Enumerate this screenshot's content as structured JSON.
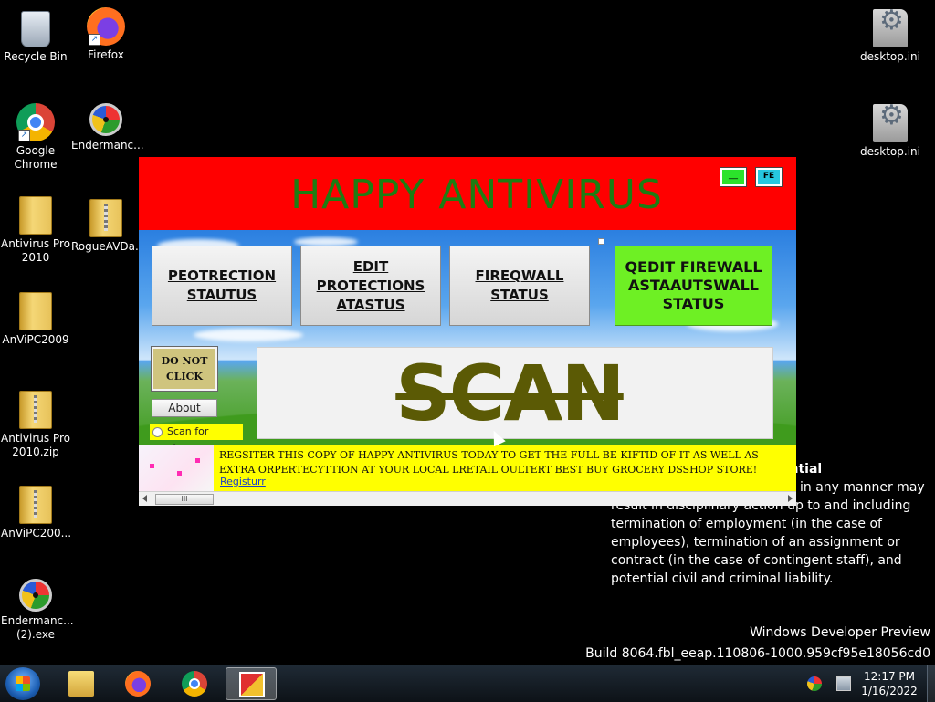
{
  "desktop": {
    "icons": [
      {
        "label": "Recycle Bin",
        "icon": "recycle-bin-icon"
      },
      {
        "label": "Firefox",
        "icon": "firefox-icon"
      },
      {
        "label": "Google Chrome",
        "icon": "chrome-icon"
      },
      {
        "label": "Endermanc...",
        "icon": "endermanch-icon"
      },
      {
        "label": "Antivirus Pro 2010",
        "icon": "folder-icon"
      },
      {
        "label": "RogueAVDa...",
        "icon": "zip-folder-icon"
      },
      {
        "label": "AnViPC2009",
        "icon": "folder-icon"
      },
      {
        "label": "Antivirus Pro 2010.zip",
        "icon": "zip-folder-icon"
      },
      {
        "label": "AnViPC200...",
        "icon": "zip-folder-icon"
      },
      {
        "label": "Endermanc... (2).exe",
        "icon": "endermanch-icon"
      },
      {
        "label": "desktop.ini",
        "icon": "settings-file-icon"
      },
      {
        "label": "desktop.ini",
        "icon": "settings-file-icon"
      }
    ],
    "legal_text": {
      "heading": "dential",
      "body": "in any manner may result in disciplinary action up to and including termination of employment (in the case of employees), termination of an assignment or contract (in the case of contingent staff), and potential civil and criminal liability."
    },
    "watermark": {
      "line1": "Windows Developer Preview",
      "line2": "Build 8064.fbl_eeap.110806-1000.959cf95e18056cd0"
    }
  },
  "antivirus": {
    "title": "HAPPY ANTIVIRUS",
    "min_label": "__",
    "close_label": "FE",
    "tiles": [
      {
        "line1": "PEOTRECTION",
        "line2": "STAUTUS",
        "line3": ""
      },
      {
        "line1": "EDIT",
        "line2": "PROTECTIONS",
        "line3": "ATASTUS"
      },
      {
        "line1": "FIREQWALL",
        "line2": "STATUS",
        "line3": ""
      },
      {
        "line1": "QEDIT FIREWALL",
        "line2": "ASTAAUTSWALL",
        "line3": "STATUS"
      }
    ],
    "do_not_click": {
      "line1": "DO NOT",
      "line2": "CLICK"
    },
    "about_label": "About",
    "scan_for_viruses_label": "Scan for viruses",
    "scan_label": "SCAN",
    "banner": {
      "text": "REGSITER THIS COPY OF HAPPY ANTIVIRUS TODAY TO GET THE FULL BE KIFTID OF IT AS WELL AS EXTRA  ORPERTECYTTION AT YOUR LOCAL LRETAIL OULTERT BEST BUY GROCERY DSSHOP STORE!",
      "link": "Registurr"
    },
    "scroll_thumb_label": "III"
  },
  "taskbar": {
    "clock_time": "12:17 PM",
    "clock_date": "1/16/2022",
    "items": [
      "File Explorer",
      "Firefox",
      "Google Chrome",
      "Happy Antivirus"
    ]
  },
  "colors": {
    "header_red": "#ff0000",
    "title_green": "#1d7d13",
    "accent_tile_green": "#6ef024",
    "banner_yellow": "#ffff00",
    "scan_olive": "#5b5a05"
  }
}
